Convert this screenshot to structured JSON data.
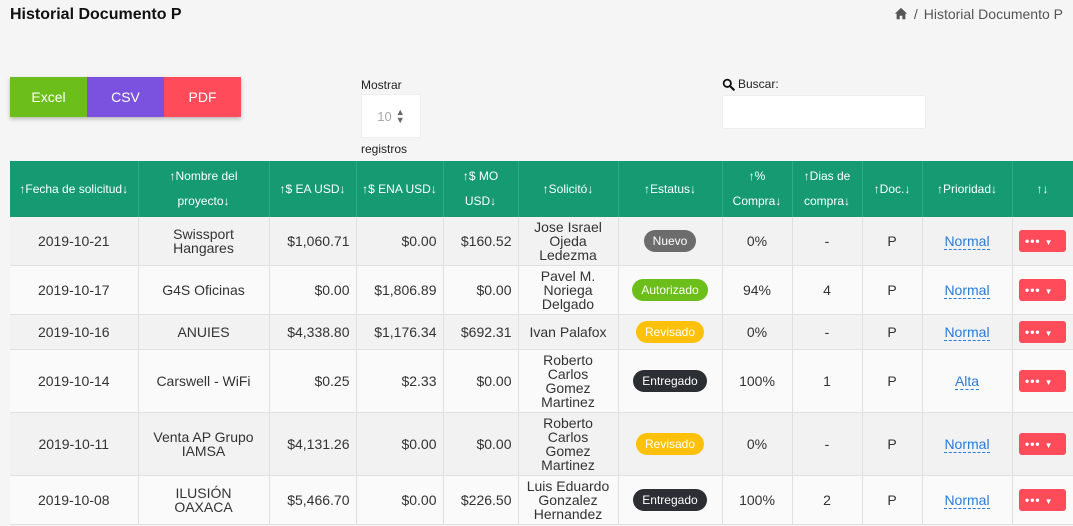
{
  "header": {
    "title": "Historial Documento P",
    "breadcrumb": "Historial Documento P",
    "home_icon": "home-icon"
  },
  "export": {
    "excel": "Excel",
    "csv": "CSV",
    "pdf": "PDF"
  },
  "length": {
    "before": "Mostrar",
    "value": "10",
    "after": "registros"
  },
  "search": {
    "label": "Buscar:",
    "value": ""
  },
  "colors": {
    "header_bg": "#159a72",
    "excel": "#6cbf1b",
    "csv": "#7b52df",
    "pdf": "#ff4b5a",
    "link": "#2a7bd8"
  },
  "columns": [
    {
      "text": "Fecha de solicitud",
      "pre": "↑",
      "post": "↓"
    },
    {
      "text": "Nombre del proyecto",
      "pre": "↑",
      "post": "↓"
    },
    {
      "text": "$ EA USD",
      "pre": "↑",
      "post": "↓"
    },
    {
      "text": "$ ENA USD",
      "pre": "↑",
      "post": "↓"
    },
    {
      "text": "$ MO USD",
      "pre": "↑",
      "post": "↓"
    },
    {
      "text": "Solicitó",
      "pre": "↑",
      "post": "↓"
    },
    {
      "text": "Estatus",
      "pre": "↑",
      "post": "↓"
    },
    {
      "text": "% Compra",
      "pre": "↑",
      "post": "↓"
    },
    {
      "text": "Dias de compra",
      "pre": "↑",
      "post": "↓"
    },
    {
      "text": "Doc.",
      "pre": "↑",
      "post": "↓"
    },
    {
      "text": "Prioridad",
      "pre": "↑",
      "post": "↓"
    },
    {
      "text": "",
      "pre": "↑",
      "post": "↓"
    }
  ],
  "status_styles": {
    "Nuevo": {
      "bg": "#6c6c6c",
      "fg": "#ffffff"
    },
    "Autorizado": {
      "bg": "#6cbf1b",
      "fg": "#ffffff"
    },
    "Revisado": {
      "bg": "#ffc107",
      "fg": "#ffffff"
    },
    "Entregado": {
      "bg": "#2b2e33",
      "fg": "#ffffff"
    }
  },
  "rows": [
    {
      "fecha": "2019-10-21",
      "proyecto": "Swissport Hangares",
      "ea": "$1,060.71",
      "ena": "$0.00",
      "mo": "$160.52",
      "solicito": "Jose Israel Ojeda Ledezma",
      "estatus": "Nuevo",
      "compra": "0%",
      "dias": "-",
      "doc": "P",
      "prioridad": "Normal",
      "action": "•••"
    },
    {
      "fecha": "2019-10-17",
      "proyecto": "G4S Oficinas",
      "ea": "$0.00",
      "ena": "$1,806.89",
      "mo": "$0.00",
      "solicito": "Pavel M. Noriega Delgado",
      "estatus": "Autorizado",
      "compra": "94%",
      "dias": "4",
      "doc": "P",
      "prioridad": "Normal",
      "action": "•••"
    },
    {
      "fecha": "2019-10-16",
      "proyecto": "ANUIES",
      "ea": "$4,338.80",
      "ena": "$1,176.34",
      "mo": "$692.31",
      "solicito": "Ivan Palafox",
      "estatus": "Revisado",
      "compra": "0%",
      "dias": "-",
      "doc": "P",
      "prioridad": "Normal",
      "action": "•••"
    },
    {
      "fecha": "2019-10-14",
      "proyecto": "Carswell - WiFi",
      "ea": "$0.25",
      "ena": "$2.33",
      "mo": "$0.00",
      "solicito": "Roberto Carlos Gomez Martinez",
      "estatus": "Entregado",
      "compra": "100%",
      "dias": "1",
      "doc": "P",
      "prioridad": "Alta",
      "action": "•••"
    },
    {
      "fecha": "2019-10-11",
      "proyecto": "Venta AP Grupo IAMSA",
      "ea": "$4,131.26",
      "ena": "$0.00",
      "mo": "$0.00",
      "solicito": "Roberto Carlos Gomez Martinez",
      "estatus": "Revisado",
      "compra": "0%",
      "dias": "-",
      "doc": "P",
      "prioridad": "Normal",
      "action": "•••"
    },
    {
      "fecha": "2019-10-08",
      "proyecto": "ILUSIÓN OAXACA",
      "ea": "$5,466.70",
      "ena": "$0.00",
      "mo": "$226.50",
      "solicito": "Luis Eduardo Gonzalez Hernandez",
      "estatus": "Entregado",
      "compra": "100%",
      "dias": "2",
      "doc": "P",
      "prioridad": "Normal",
      "action": "•••"
    }
  ]
}
